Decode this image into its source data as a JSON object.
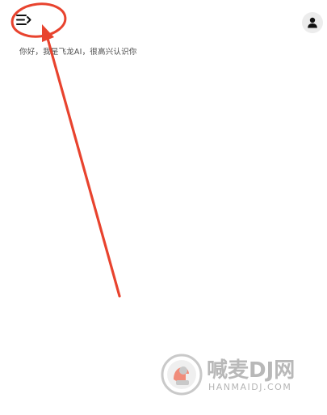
{
  "header": {
    "menu_icon": "sidebar-menu-icon",
    "avatar_icon": "user-icon"
  },
  "chat": {
    "greeting": "你好，我是飞龙AI，很高兴认识你"
  },
  "annotation": {
    "color": "#e8432e"
  },
  "watermark": {
    "text": "喊麦DJ网",
    "url_text": "HANMAIDJ.COM",
    "logo_color": "#c9c9c9",
    "accent_color": "#f08c7a"
  }
}
